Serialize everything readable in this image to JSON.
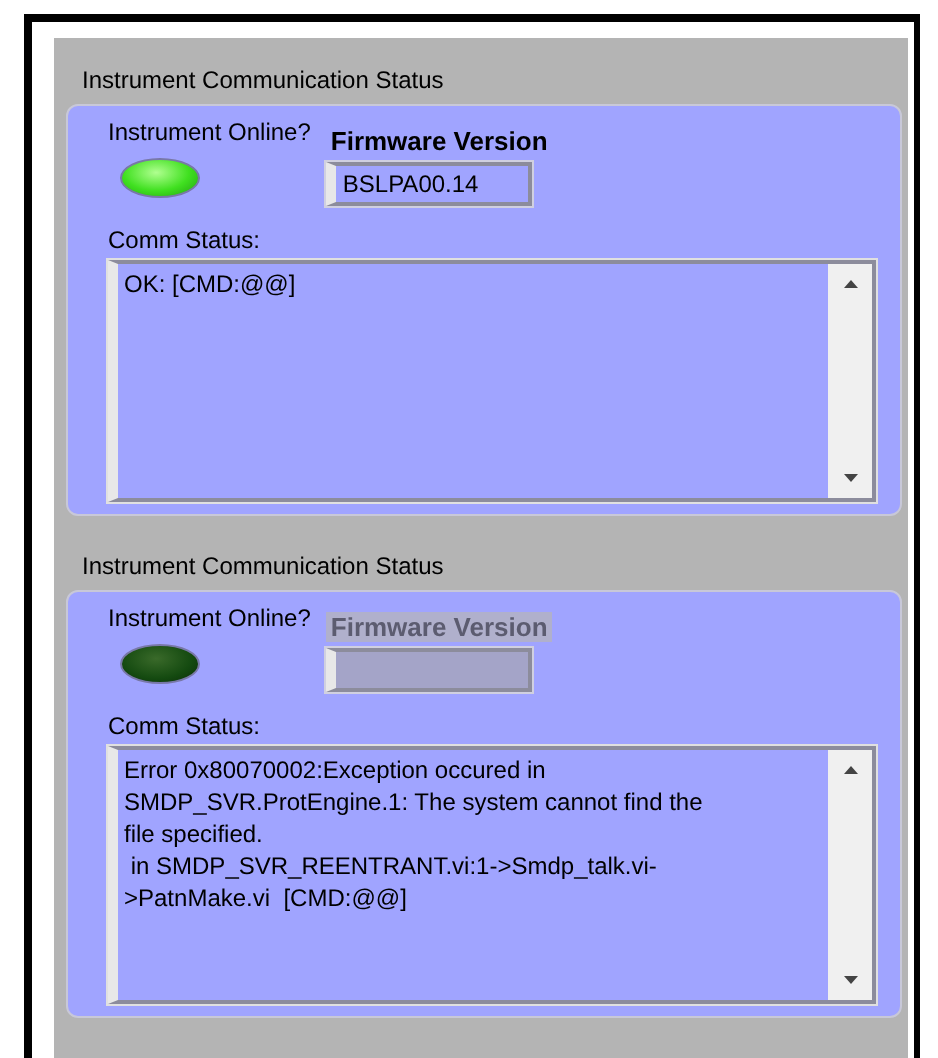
{
  "panels": [
    {
      "title": "Instrument Communication Status",
      "online_label": "Instrument Online?",
      "online": true,
      "firmware": {
        "label": "Firmware Version",
        "value": "BSLPA00.14",
        "disabled": false
      },
      "comm_label": "Comm Status:",
      "comm_value": "OK: [CMD:@@]"
    },
    {
      "title": "Instrument Communication Status",
      "online_label": "Instrument Online?",
      "online": false,
      "firmware": {
        "label": "Firmware Version",
        "disabled": true
      },
      "comm_label": "Comm Status:",
      "comm_value": "Error 0x80070002:Exception occured in SMDP_SVR.ProtEngine.1: The system cannot find the file specified.\n in SMDP_SVR_REENTRANT.vi:1->Smdp_talk.vi->PatnMake.vi  [CMD:@@]"
    }
  ]
}
